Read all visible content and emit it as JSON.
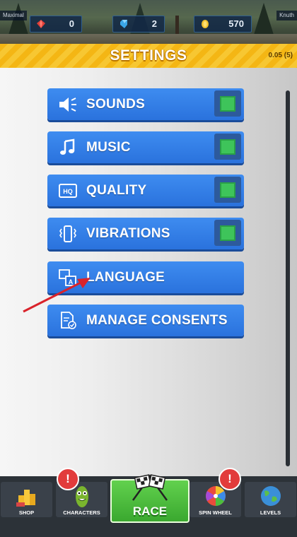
{
  "top_bar": {
    "player_left": "Maximal",
    "player_right": "Knuth",
    "stats": [
      {
        "icon": "red-gem-icon",
        "value": "0"
      },
      {
        "icon": "blue-gem-icon",
        "value": "2"
      },
      {
        "icon": "coin-icon",
        "value": "570"
      }
    ]
  },
  "header": {
    "title": "SETTINGS",
    "version": "0.05 (5)"
  },
  "settings": [
    {
      "label": "SOUNDS",
      "icon": "speaker-icon",
      "toggle": true
    },
    {
      "label": "MUSIC",
      "icon": "music-note-icon",
      "toggle": true
    },
    {
      "label": "QUALITY",
      "icon": "hq-icon",
      "toggle": true
    },
    {
      "label": "VIBRATIONS",
      "icon": "vibration-icon",
      "toggle": true
    },
    {
      "label": "LANGUAGE",
      "icon": "language-icon",
      "toggle": false
    },
    {
      "label": "MANAGE CONSENTS",
      "icon": "consent-document-icon",
      "toggle": false
    }
  ],
  "colors": {
    "header_yellow": "#f4b614",
    "button_blue": "#2a72dd",
    "toggle_green": "#3ec45a",
    "race_green": "#4cbe3e",
    "arrow_red": "#d9232b"
  },
  "nav": {
    "shop": "SHOP",
    "characters": "CHARACTERS",
    "race": "RACE",
    "spin_wheel": "SPIN WHEEL",
    "levels": "LEVELS",
    "badge_text": "!"
  }
}
